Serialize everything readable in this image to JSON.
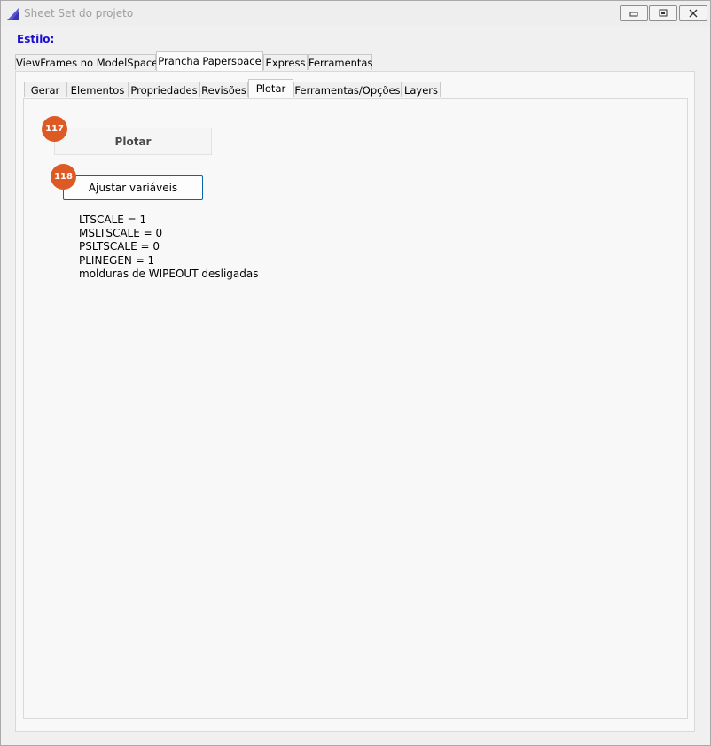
{
  "window": {
    "title": "Sheet Set do projeto",
    "controls": [
      "minimize",
      "restore",
      "close"
    ]
  },
  "style_label": "Estilo:",
  "main_tabs": [
    {
      "label": "ViewFrames no ModelSpace",
      "active": false
    },
    {
      "label": "Prancha Paperspace",
      "active": true
    },
    {
      "label": "Express",
      "active": false
    },
    {
      "label": "Ferramentas",
      "active": false
    }
  ],
  "sub_tabs": [
    {
      "label": "Gerar",
      "active": false
    },
    {
      "label": "Elementos",
      "active": false
    },
    {
      "label": "Propriedades",
      "active": false
    },
    {
      "label": "Revisões",
      "active": false
    },
    {
      "label": "Plotar",
      "active": true
    },
    {
      "label": "Ferramentas/Opções",
      "active": false
    },
    {
      "label": "Layers",
      "active": false
    }
  ],
  "buttons": {
    "plotar": {
      "label": "Plotar",
      "badge": "117"
    },
    "ajustar": {
      "label": "Ajustar variáveis",
      "badge": "118"
    }
  },
  "variables_info": [
    "LTSCALE = 1",
    "MSLTSCALE = 0",
    "PSLTSCALE = 0",
    "PLINEGEN = 1",
    "molduras de WIPEOUT desligadas"
  ],
  "colors": {
    "badge": "#de5a24",
    "style_label": "#1a0fd0",
    "focus_border": "#0a64a8"
  }
}
